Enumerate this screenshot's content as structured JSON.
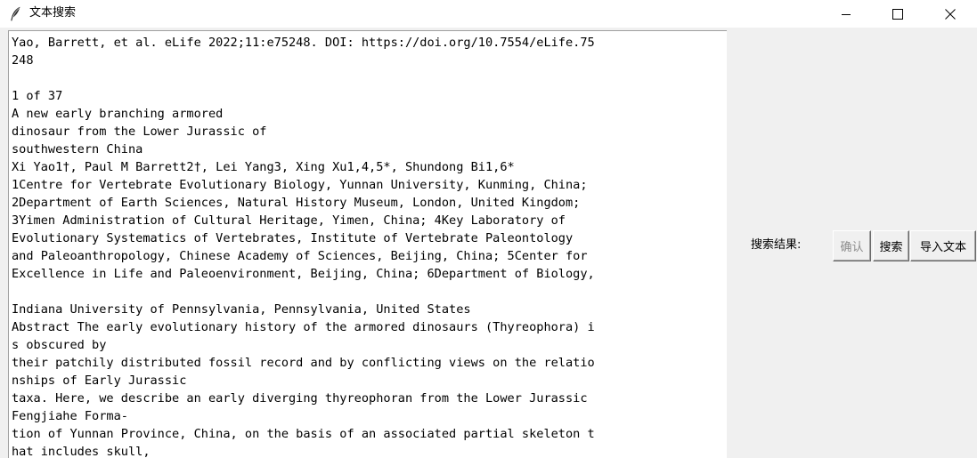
{
  "window": {
    "title": "文本搜索",
    "controls": {
      "minimize_icon": "minimize-icon",
      "maximize_icon": "maximize-icon",
      "close_icon": "close-icon"
    }
  },
  "text_area": {
    "lines": [
      "Yao, Barrett, et al. eLife 2022;11:e75248. DOI: https://doi.org/10.7554/eLife.75",
      "248",
      "",
      "1 of 37",
      "A new early branching armored",
      "dinosaur from the Lower Jurassic of",
      "southwestern China",
      "Xi Yao1†, Paul M Barrett2†, Lei Yang3, Xing Xu1,4,5*, Shundong Bi1,6*",
      "1Centre for Vertebrate Evolutionary Biology, Yunnan University, Kunming, China;",
      "2Department of Earth Sciences, Natural History Museum, London, United Kingdom;",
      "3Yimen Administration of Cultural Heritage, Yimen, China; 4Key Laboratory of",
      "Evolutionary Systematics of Vertebrates, Institute of Vertebrate Paleontology",
      "and Paleoanthropology, Chinese Academy of Sciences, Beijing, China; 5Center for",
      "Excellence in Life and Paleoenvironment, Beijing, China; 6Department of Biology,",
      "",
      "Indiana University of Pennsylvania, Pennsylvania, United States",
      "Abstract The early evolutionary history of the armored dinosaurs (Thyreophora) i",
      "s obscured by",
      "their patchily distributed fossil record and by conflicting views on the relatio",
      "nships of Early Jurassic",
      "taxa. Here, we describe an early diverging thyreophoran from the Lower Jurassic",
      "Fengjiahe Forma-",
      "tion of Yunnan Province, China, on the basis of an associated partial skeleton t",
      "hat includes skull,"
    ]
  },
  "sidebar": {
    "result_label": "搜索结果:",
    "confirm_label": "确认",
    "confirm_enabled": false,
    "search_label": "搜索",
    "import_label": "导入文本"
  }
}
